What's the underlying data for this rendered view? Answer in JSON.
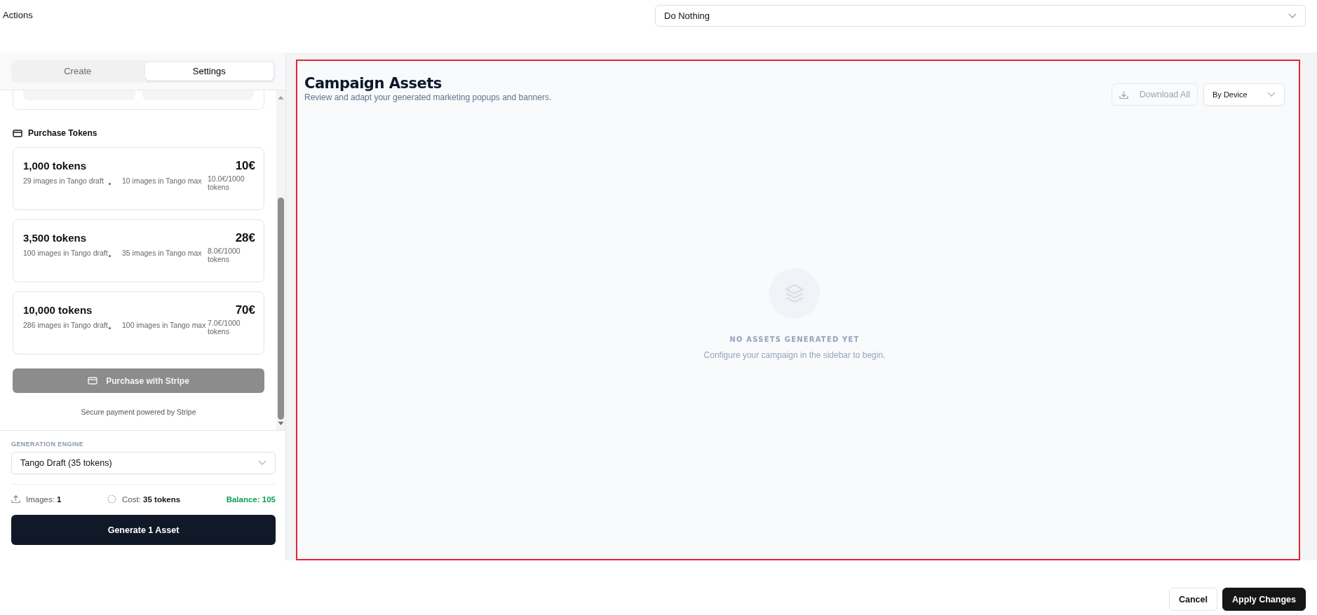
{
  "header": {
    "label": "Actions",
    "action_select": {
      "value": "Do Nothing"
    }
  },
  "sidebar": {
    "tabs": [
      {
        "label": "Create",
        "selected": false
      },
      {
        "label": "Settings",
        "selected": true
      }
    ],
    "purchase": {
      "title": "Purchase Tokens",
      "packages": [
        {
          "tokens": "1,000 tokens",
          "price": "10€",
          "rate": "10.0€/1000 tokens",
          "features": [
            "29 images in Tango draft",
            "10 images in Tango max"
          ]
        },
        {
          "tokens": "3,500 tokens",
          "price": "28€",
          "rate": "8.0€/1000 tokens",
          "features": [
            "100 images in Tango draft",
            "35 images in Tango max"
          ]
        },
        {
          "tokens": "10,000 tokens",
          "price": "70€",
          "rate": "7.0€/1000 tokens",
          "features": [
            "286 images in Tango draft",
            "100 images in Tango max"
          ]
        }
      ],
      "button": {
        "label": "Purchase with Stripe",
        "disabled": true
      },
      "note": "Secure payment powered by Stripe"
    },
    "engine": {
      "label": "GENERATION ENGINE",
      "value": "Tango Draft (35 tokens)"
    },
    "stats": {
      "images": "Images: **1**",
      "cost": "Cost: **35 tokens**",
      "balance": "Balance: 105"
    },
    "generate_button": "Generate 1 Asset"
  },
  "assets": {
    "title": "Campaign Assets",
    "subtitle": "Review and adapt your generated marketing popups and banners.",
    "download_button": {
      "label": "Download All",
      "disabled": true
    },
    "view_select": {
      "value": "By Device"
    },
    "empty_title": "NO ASSETS GENERATED YET",
    "empty_text": "Configure your campaign in the sidebar to begin."
  },
  "footer": {
    "buttons": [
      {
        "label": "Cancel",
        "kind": "secondary"
      },
      {
        "label": "Apply Changes",
        "kind": "primary"
      }
    ]
  }
}
